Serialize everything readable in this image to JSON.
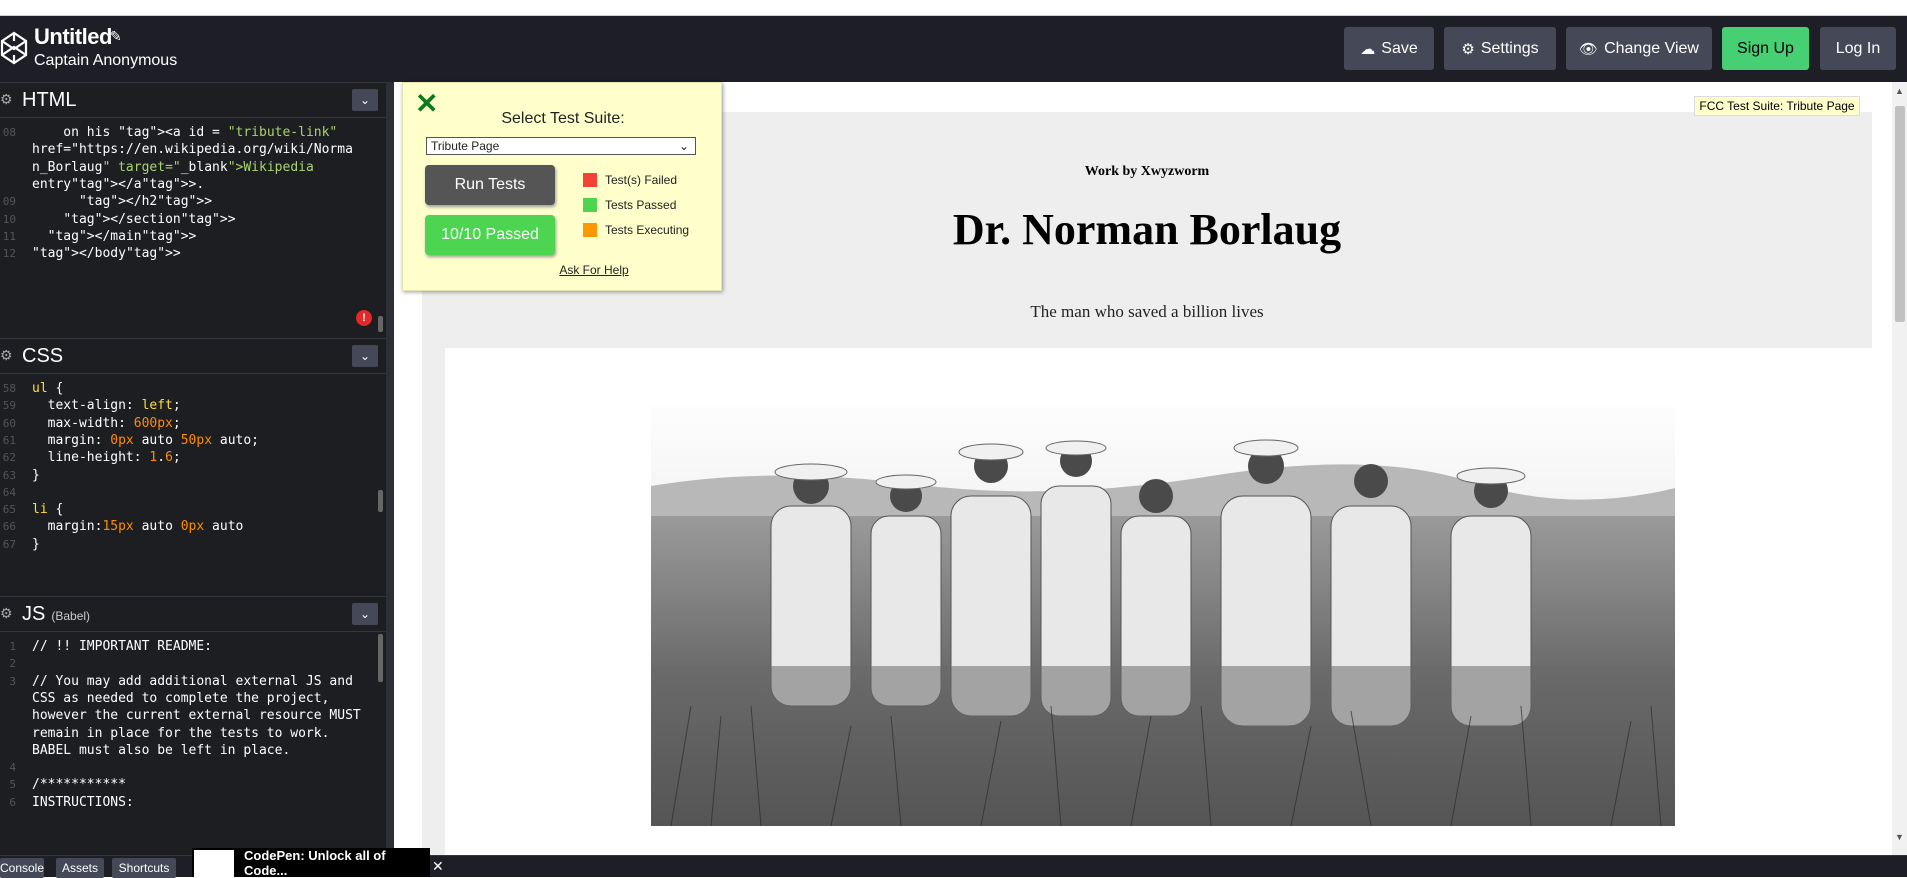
{
  "header": {
    "title": "Untitled",
    "author": "Captain Anonymous",
    "buttons": {
      "save": "Save",
      "settings": "Settings",
      "change_view": "Change View",
      "signup": "Sign Up",
      "login": "Log In"
    }
  },
  "editors": {
    "html": {
      "label": "HTML",
      "lines": [
        {
          "n": "08",
          "code": "    on his <a id = \"tribute-link\""
        },
        {
          "n": "",
          "code": "href=\"https://en.wikipedia.org/wiki/Norma"
        },
        {
          "n": "",
          "code": "n_Borlaug\" target=\"_blank\">Wikipedia"
        },
        {
          "n": "",
          "code": "entry</a>."
        },
        {
          "n": "09",
          "code": "      </h2>"
        },
        {
          "n": "10",
          "code": "    </section>"
        },
        {
          "n": "11",
          "code": "  </main>"
        },
        {
          "n": "12",
          "code": "</body>"
        }
      ]
    },
    "css": {
      "label": "CSS",
      "lines": [
        {
          "n": "58",
          "code": "ul {"
        },
        {
          "n": "59",
          "code": "  text-align: left;"
        },
        {
          "n": "60",
          "code": "  max-width: 600px;"
        },
        {
          "n": "61",
          "code": "  margin: 0px auto 50px auto;"
        },
        {
          "n": "62",
          "code": "  line-height: 1.6;"
        },
        {
          "n": "63",
          "code": "}"
        },
        {
          "n": "64",
          "code": ""
        },
        {
          "n": "65",
          "code": "li {"
        },
        {
          "n": "66",
          "code": "  margin:15px auto 0px auto"
        },
        {
          "n": "67",
          "code": "}"
        }
      ]
    },
    "js": {
      "label": "JS",
      "sub": "(Babel)",
      "lines": [
        {
          "n": "1",
          "code": "// !! IMPORTANT README:"
        },
        {
          "n": "2",
          "code": ""
        },
        {
          "n": "3",
          "code": "// You may add additional external JS and"
        },
        {
          "n": "",
          "code": "CSS as needed to complete the project,"
        },
        {
          "n": "",
          "code": "however the current external resource MUST"
        },
        {
          "n": "",
          "code": "remain in place for the tests to work."
        },
        {
          "n": "",
          "code": "BABEL must also be left in place."
        },
        {
          "n": "4",
          "code": ""
        },
        {
          "n": "5",
          "code": "/***********"
        },
        {
          "n": "6",
          "code": "INSTRUCTIONS:"
        }
      ]
    }
  },
  "preview": {
    "work_by": "Work by Xwyzworm",
    "heading": "Dr. Norman Borlaug",
    "tagline": "The man who saved a billion lives",
    "fcc_badge": "FCC Test Suite: Tribute Page"
  },
  "test_suite": {
    "close": "✕",
    "select_label": "Select Test Suite:",
    "selected": "Tribute Page",
    "run_button": "Run Tests",
    "result_button": "10/10 Passed",
    "legend": [
      {
        "label": "Test(s) Failed",
        "color": "#f44336"
      },
      {
        "label": "Tests Passed",
        "color": "#4dd552"
      },
      {
        "label": "Tests Executing",
        "color": "#ff9800"
      }
    ],
    "help_link": "Ask For Help"
  },
  "footer": {
    "console": "Console",
    "assets": "Assets",
    "shortcuts": "Shortcuts",
    "promo": "CodePen: Unlock all of Code..."
  }
}
